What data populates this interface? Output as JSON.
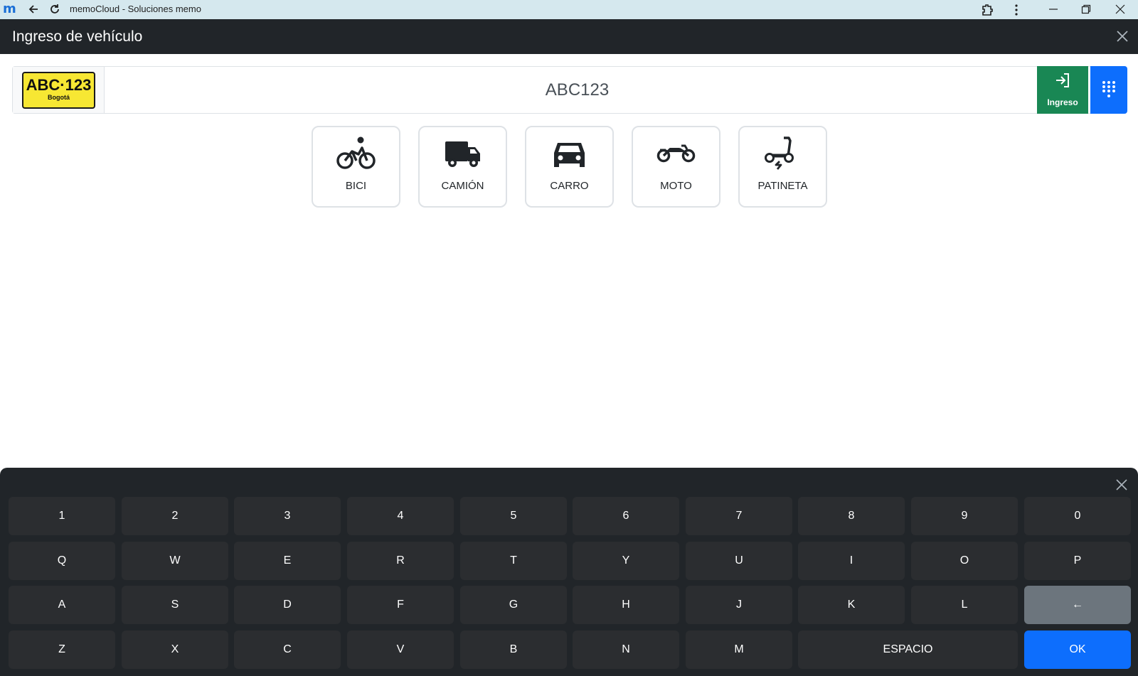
{
  "browser": {
    "logo": "m",
    "title": "memoCloud - Soluciones memo"
  },
  "header": {
    "title": "Ingreso de vehículo"
  },
  "plate": {
    "badge_number": "ABC·123",
    "badge_city": "Bogotá",
    "value": "ABC123"
  },
  "actions": {
    "ingreso_label": "Ingreso"
  },
  "vehicles": [
    {
      "label": "BICI",
      "icon": "bicycle-icon"
    },
    {
      "label": "CAMIÓN",
      "icon": "truck-icon"
    },
    {
      "label": "CARRO",
      "icon": "car-icon"
    },
    {
      "label": "MOTO",
      "icon": "motorcycle-icon"
    },
    {
      "label": "PATINETA",
      "icon": "scooter-icon"
    }
  ],
  "keyboard": {
    "row1": [
      "1",
      "2",
      "3",
      "4",
      "5",
      "6",
      "7",
      "8",
      "9",
      "0"
    ],
    "row2": [
      "Q",
      "W",
      "E",
      "R",
      "T",
      "Y",
      "U",
      "I",
      "O",
      "P"
    ],
    "row3": [
      "A",
      "S",
      "D",
      "F",
      "G",
      "H",
      "J",
      "K",
      "L"
    ],
    "backspace": "←",
    "row4": [
      "Z",
      "X",
      "C",
      "V",
      "B",
      "N",
      "M"
    ],
    "space": "ESPACIO",
    "ok": "OK"
  },
  "colors": {
    "header_bg": "#212529",
    "ingreso_green": "#198754",
    "primary_blue": "#0d6efd",
    "plate_yellow": "#f7e733",
    "key_bg": "#2b2d30",
    "backspace_gray": "#6c757d"
  }
}
